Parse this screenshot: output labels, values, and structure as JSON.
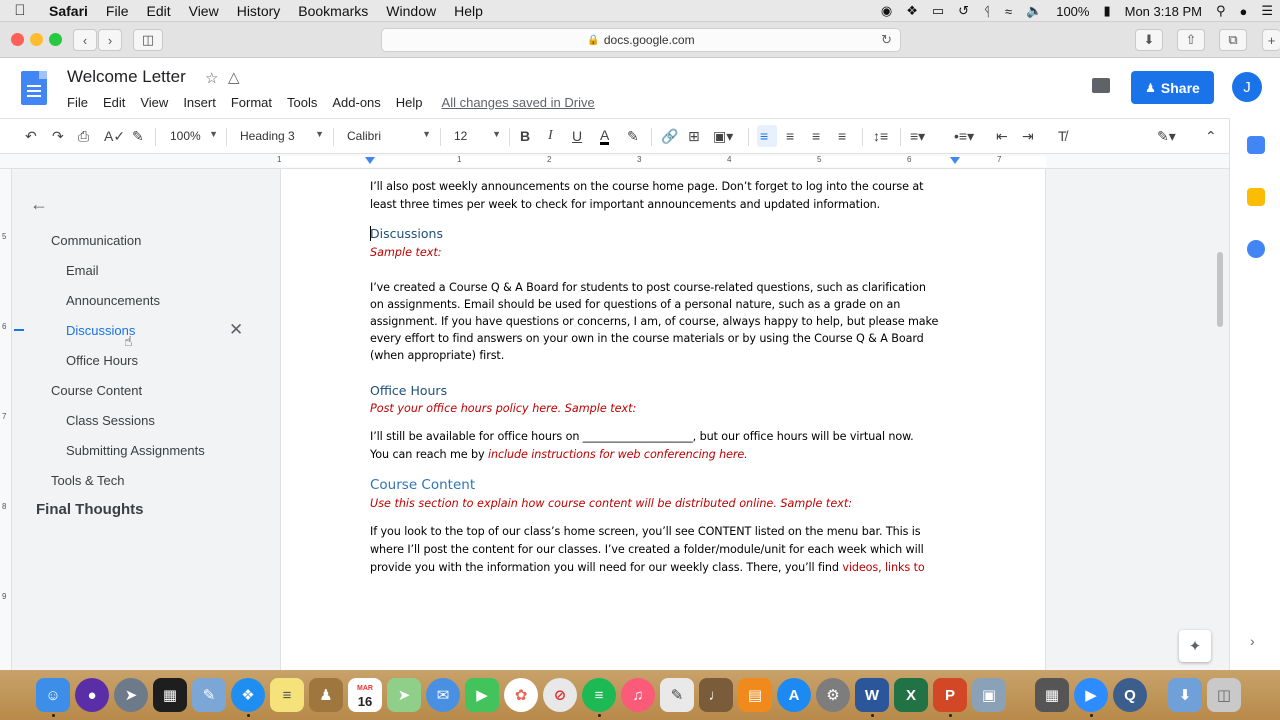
{
  "menubar": {
    "app": "Safari",
    "items": [
      "File",
      "Edit",
      "View",
      "History",
      "Bookmarks",
      "Window",
      "Help"
    ],
    "battery": "100%",
    "clock": "Mon 3:18 PM"
  },
  "browser": {
    "url": "docs.google.com"
  },
  "docs": {
    "title": "Welcome Letter",
    "menu": [
      "File",
      "Edit",
      "View",
      "Insert",
      "Format",
      "Tools",
      "Add-ons",
      "Help"
    ],
    "saved_status": "All changes saved in Drive",
    "share_label": "Share",
    "avatar_initial": "J",
    "colors": {
      "accent": "#1a73e8",
      "heading": "#1f4e79",
      "sample": "#c00000"
    }
  },
  "toolbar": {
    "zoom": "100%",
    "style": "Heading 3",
    "font": "Calibri",
    "size": "12",
    "bold": "B",
    "italic": "I",
    "underline": "U",
    "text_color": "A"
  },
  "ruler": {
    "numbers": [
      "1",
      "1",
      "2",
      "3",
      "4",
      "5",
      "6",
      "7"
    ],
    "vertical_numbers": [
      "5",
      "6",
      "7",
      "8",
      "9"
    ]
  },
  "outline": {
    "items": [
      {
        "label": "Communication",
        "level": 1
      },
      {
        "label": "Email",
        "level": 2
      },
      {
        "label": "Announcements",
        "level": 2
      },
      {
        "label": "Discussions",
        "level": 2,
        "active": true
      },
      {
        "label": "Office Hours",
        "level": 2
      },
      {
        "label": "Course Content",
        "level": 1
      },
      {
        "label": "Class Sessions",
        "level": 2
      },
      {
        "label": "Submitting Assignments",
        "level": 2
      },
      {
        "label": "Tools & Tech",
        "level": 1
      },
      {
        "label": "Final Thoughts",
        "level": 0
      }
    ]
  },
  "document": {
    "intro": [
      "I’ll also post weekly announcements on the course home page.  Don’t forget to log into the course at",
      "least three times per week to check for important announcements and updated information."
    ],
    "discussions": {
      "heading": "Discussions",
      "sample": "Sample text:",
      "body": [
        "I’ve created a Course Q & A Board for students to post course-related questions, such as clarification",
        "on assignments.  Email should be used for questions of a personal nature, such as a grade on an",
        "assignment.  If you have questions or concerns, I am, of course, always happy to help, but please make",
        "every effort to find answers on your own in the course materials or by using the Course Q & A Board",
        "(when appropriate) first."
      ]
    },
    "office_hours": {
      "heading": "Office Hours",
      "sample": "Post your office hours policy here.  Sample text:",
      "body_1": "I’ll still be available for office hours on ____________________, but our office hours will be virtual now.",
      "body_2_prefix": "You can reach me by ",
      "body_2_red": "include instructions for web conferencing here."
    },
    "course_content": {
      "heading": "Course Content",
      "sample": "Use this section to explain how course content will be distributed online.  Sample text:",
      "body_1": "If you look to the top of our class’s home screen, you’ll see CONTENT listed on the menu bar.  This is",
      "body_2": "where I’ll post the content for our classes.  I’ve created a folder/module/unit for each week which will",
      "body_3_prefix": "provide you with the information you will need for our weekly class.  There, you’ll find ",
      "body_3_red": "videos, links to"
    }
  },
  "dock": {
    "calendar_month": "MAR",
    "calendar_day": "16"
  }
}
